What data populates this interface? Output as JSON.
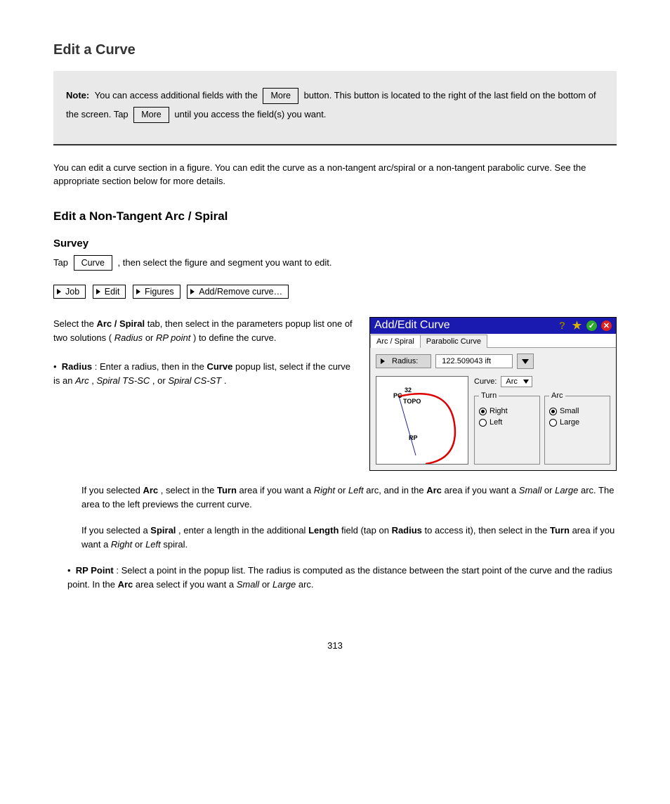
{
  "heading": "Edit a Curve",
  "note": {
    "lead": "Note:",
    "text_parts": [
      "You can access additional fields with the ",
      " button. This button is located to the right of the last field on the bottom of the screen. Tap ",
      " until you access the field(s) you want."
    ],
    "btn_more": "More",
    "btn_more2": "More"
  },
  "para1": "You can edit a curve section in a figure. You can edit the curve as a non-tangent arc/spiral or a non-tangent parabolic curve. See the appropriate section below for more details.",
  "h_arc_spiral": "Edit a Non-Tangent Arc / Spiral",
  "h_survey": "Survey",
  "lead_inline": {
    "prefix": "Tap ",
    "suffix": ", then select the figure and segment you want to edit.",
    "btn_curve": "Curve"
  },
  "path": [
    "Job",
    "Edit",
    "Figures",
    "Add/Remove curve…"
  ],
  "col_left": {
    "p1_a": "Select the ",
    "p1_tab": "Arc / Spiral",
    "p1_b": " tab, then select in the parameters popup list one of two solutions (",
    "p1_b1": "Radius",
    "p1_b2": " or ",
    "p1_b3": "RP point",
    "p1_b4": ") to define the curve.",
    "bullet1_a": "Radius",
    "bullet1_b": ": Enter a radius, then in the ",
    "bullet1_c": "Curve",
    "bullet1_d": " popup list, select if the curve is an ",
    "bullet1_e": "Arc",
    "bullet1_f": ", ",
    "bullet1_g": "Spiral TS-SC",
    "bullet1_h": ", or ",
    "bullet1_i": "Spiral CS-ST",
    "bullet1_j": "."
  },
  "col_below": {
    "arc_a": "If you selected ",
    "arc_b": "Arc",
    "arc_c": ", select in the ",
    "arc_d": "Turn",
    "arc_e": " area if you want a ",
    "arc_f": "Right",
    "arc_g": " or ",
    "arc_h": "Left",
    "arc_i": " arc, and in the ",
    "arc_j": "Arc",
    "arc_k": " area if you want a ",
    "arc_l": "Small",
    "arc_m": " or ",
    "arc_n": "Large",
    "arc_o": " arc. The area to the left previews the current curve.",
    "sp_a": "If you selected a ",
    "sp_b": "Spiral",
    "sp_c": ", enter a length in the additional ",
    "sp_d": "Length",
    "sp_e": " field (tap on ",
    "sp_f": "Radius",
    "sp_g": " to access it), then select in the ",
    "sp_h": "Turn",
    "sp_i": " area if you want a ",
    "sp_j": "Right",
    "sp_k": " or ",
    "sp_l": "Left",
    "sp_m": " spiral.",
    "rp_head": "RP Point",
    "rp_a": ": Select a point in the popup list. The radius is computed as the distance between the start point of the curve and the radius point. In the ",
    "rp_b": "Arc",
    "rp_c": " area select if you want a ",
    "rp_d": "Small",
    "rp_e": " or ",
    "rp_f": "Large",
    "rp_g": " arc."
  },
  "dialog": {
    "title": "Add/Edit Curve",
    "tabs": {
      "arc": "Arc / Spiral",
      "para": "Parabolic Curve"
    },
    "param_btn": "Radius:",
    "param_val": "122.509043 ift",
    "curve_lbl": "Curve:",
    "curve_sel": "Arc",
    "grp_turn": "Turn",
    "grp_arc": "Arc",
    "opt_right": "Right",
    "opt_left": "Left",
    "opt_small": "Small",
    "opt_large": "Large",
    "preview_labels": {
      "pc": "PC",
      "num": "32",
      "topo": "TOPO",
      "rp": "RP"
    }
  },
  "page_number": "313"
}
